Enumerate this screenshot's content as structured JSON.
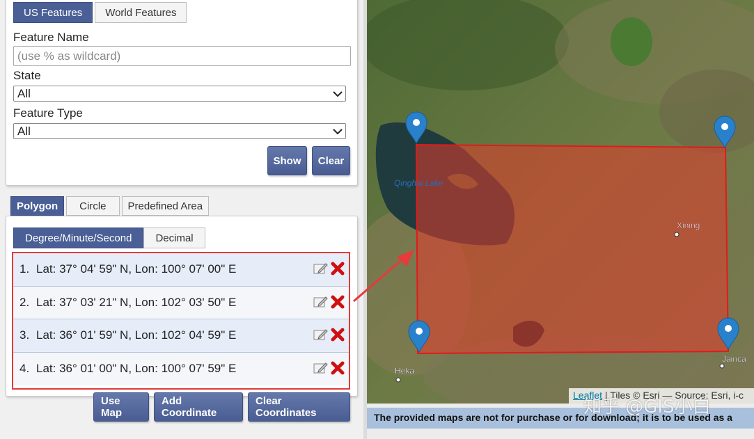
{
  "feature_tabs": [
    {
      "label": "US Features",
      "active": true
    },
    {
      "label": "World Features",
      "active": false
    }
  ],
  "feature_name": {
    "label": "Feature Name",
    "placeholder": "(use % as wildcard)",
    "value": ""
  },
  "state": {
    "label": "State",
    "value": "All"
  },
  "feature_type": {
    "label": "Feature Type",
    "value": "All"
  },
  "search_buttons": {
    "show": "Show",
    "clear": "Clear"
  },
  "shape_tabs": [
    {
      "label": "Polygon",
      "active": true
    },
    {
      "label": "Circle",
      "active": false
    },
    {
      "label": "Predefined Area",
      "active": false
    }
  ],
  "format_tabs": [
    {
      "label": "Degree/Minute/Second",
      "active": true
    },
    {
      "label": "Decimal",
      "active": false
    }
  ],
  "coordinates": [
    {
      "num": "1.",
      "text": "Lat: 37° 04' 59\" N, Lon: 100° 07' 00\" E"
    },
    {
      "num": "2.",
      "text": "Lat: 37° 03' 21\" N, Lon: 102° 03' 50\" E"
    },
    {
      "num": "3.",
      "text": "Lat: 36° 01' 59\" N, Lon: 102° 04' 59\" E"
    },
    {
      "num": "4.",
      "text": "Lat: 36° 01' 00\" N, Lon: 100° 07' 59\" E"
    }
  ],
  "coord_buttons": {
    "use_map": "Use Map",
    "add": "Add Coordinate",
    "clear": "Clear Coordinates"
  },
  "map": {
    "labels": {
      "lake": "Qinghai Lake",
      "xining": "Xining",
      "heka": "Heka",
      "jainca": "Jainca"
    },
    "attribution": {
      "leaflet": "Leaflet",
      "rest": " | Tiles © Esri — Source: Esri, i-c"
    },
    "notice": "The provided maps are not for purchase or for download; it is to be used as a",
    "watermark": "知乎 @GIS小白"
  },
  "colors": {
    "accent": "#4a5f96",
    "polygon": "#e53b2c",
    "marker": "#2a81cb",
    "highlight_border": "#e03a3a"
  }
}
